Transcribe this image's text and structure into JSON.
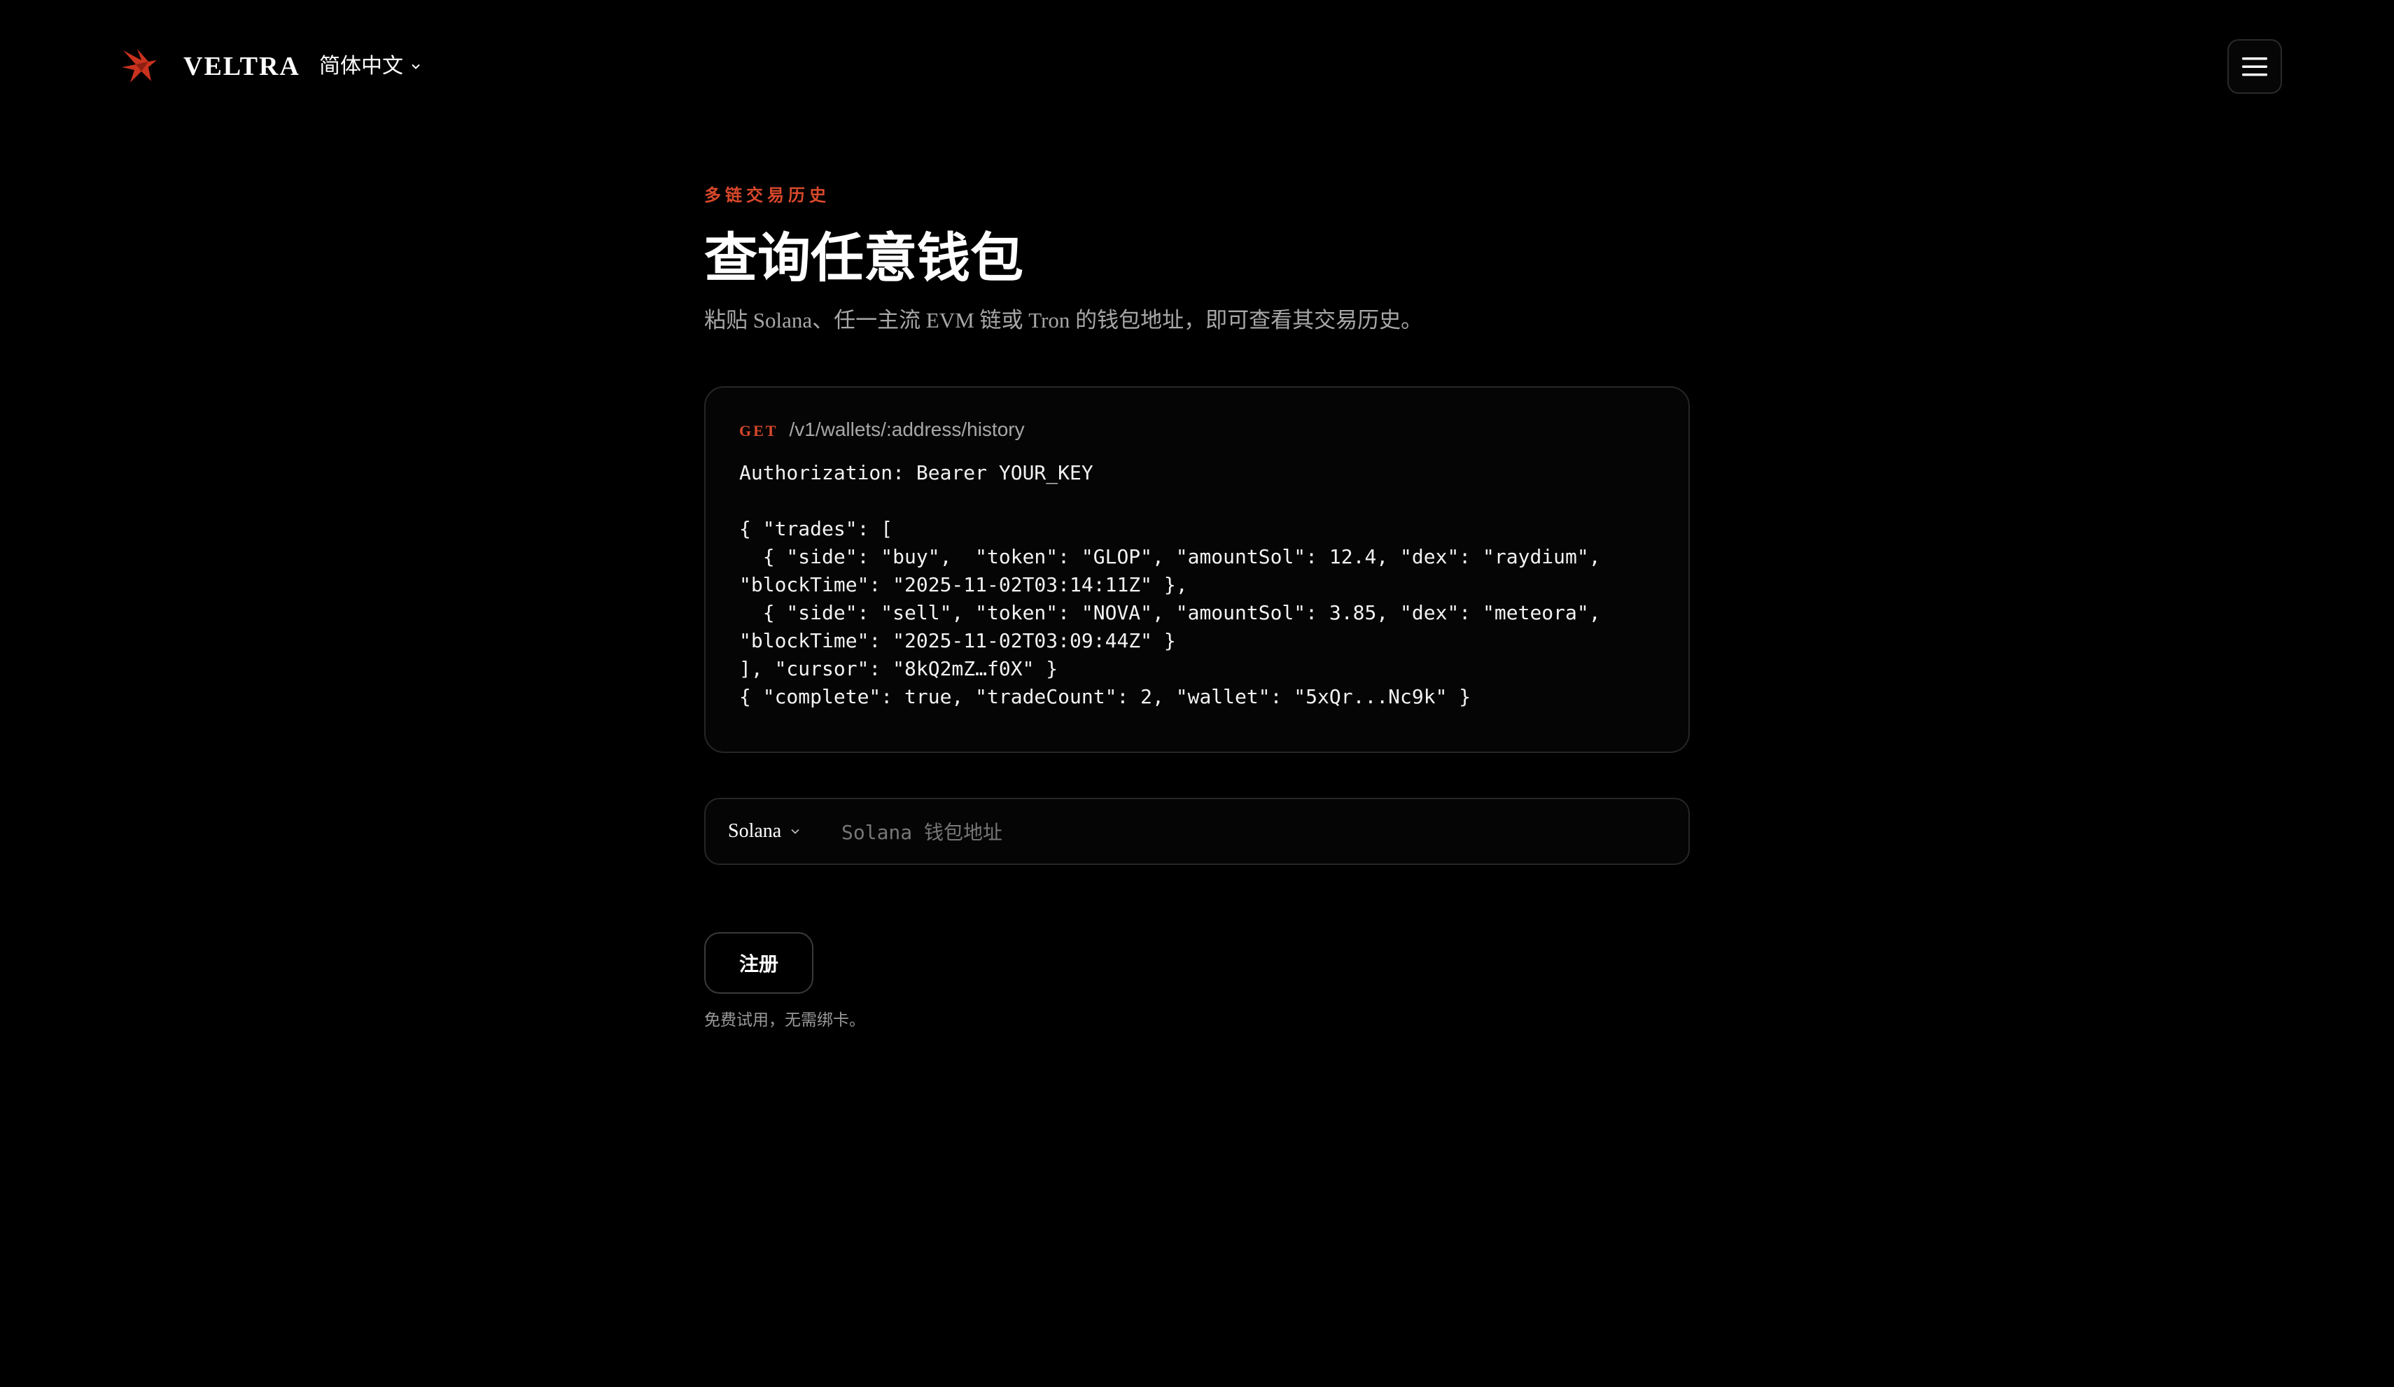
{
  "header": {
    "brand": "VELTRA",
    "language": "简体中文",
    "menu_icon": "hamburger-icon",
    "logo_icon": "bird-logo-icon"
  },
  "hero": {
    "eyebrow": "多链交易历史",
    "title": "查询任意钱包",
    "subtitle": "粘贴 Solana、任一主流 EVM 链或 Tron 的钱包地址，即可查看其交易历史。"
  },
  "request": {
    "method": "GET",
    "endpoint": "/v1/wallets/:address/history",
    "body": "Authorization: Bearer YOUR_KEY\n\n{ \"trades\": [\n  { \"side\": \"buy\",  \"token\": \"GLOP\", \"amountSol\": 12.4, \"dex\": \"raydium\",\n\"blockTime\": \"2025-11-02T03:14:11Z\" },\n  { \"side\": \"sell\", \"token\": \"NOVA\", \"amountSol\": 3.85, \"dex\": \"meteora\",\n\"blockTime\": \"2025-11-02T03:09:44Z\" }\n], \"cursor\": \"8kQ2mZ…f0X\" }\n{ \"complete\": true, \"tradeCount\": 2, \"wallet\": \"5xQr...Nc9k\" }"
  },
  "lookup": {
    "chain": "Solana",
    "value": "",
    "placeholder": "Solana 钱包地址"
  },
  "cta": {
    "signup_label": "注册",
    "note": "免费试用，无需绑卡。"
  },
  "colors": {
    "background": "#000000",
    "accent": "#d9482b",
    "border": "#262626",
    "muted_text": "#a7a7a7"
  }
}
